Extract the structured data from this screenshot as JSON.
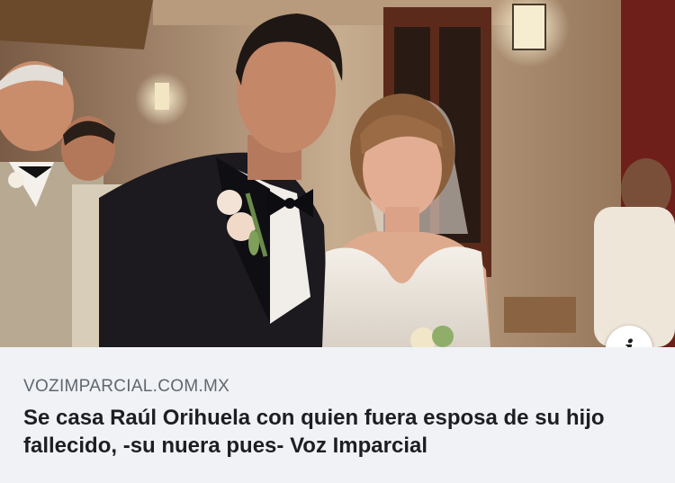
{
  "link_preview": {
    "domain": "VOZIMPARCIAL.COM.MX",
    "headline": "Se casa Raúl Orihuela con quien fuera esposa de su hijo fallecido, -su nuera pues- Voz Imparcial",
    "info_icon": "i"
  },
  "photo": {
    "icon": "wedding-photo"
  }
}
